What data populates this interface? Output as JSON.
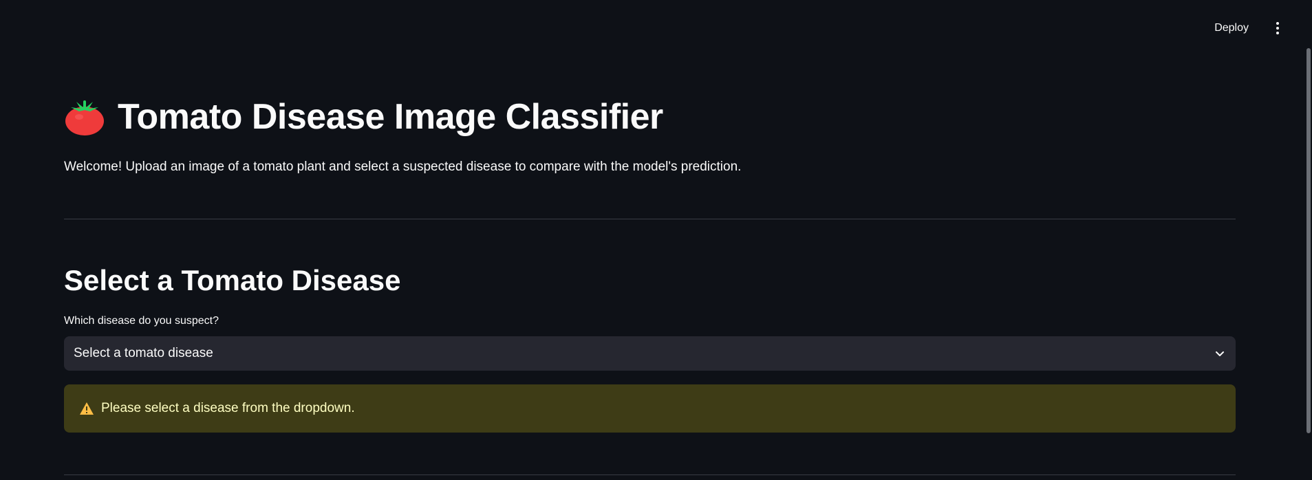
{
  "header": {
    "deploy_label": "Deploy",
    "menu_icon": "more-vertical-icon"
  },
  "main": {
    "title": "Tomato Disease Image Classifier",
    "title_icon": "tomato-icon",
    "welcome": "Welcome! Upload an image of a tomato plant and select a suspected disease to compare with the model's prediction.",
    "section_title": "Select a Tomato Disease",
    "select": {
      "label": "Which disease do you suspect?",
      "value": "Select a tomato disease",
      "icon": "chevron-down-icon"
    },
    "warning": {
      "icon": "warning-icon",
      "text": "Please select a disease from the dropdown."
    }
  },
  "colors": {
    "background": "#0e1117",
    "text": "#fafafa",
    "select_bg": "#262730",
    "warning_bg": "#3e3c16",
    "warning_text": "#ffffc2",
    "warning_icon": "#ffbd45",
    "tomato_red": "#ef3b3b",
    "tomato_leaf": "#23d160"
  }
}
